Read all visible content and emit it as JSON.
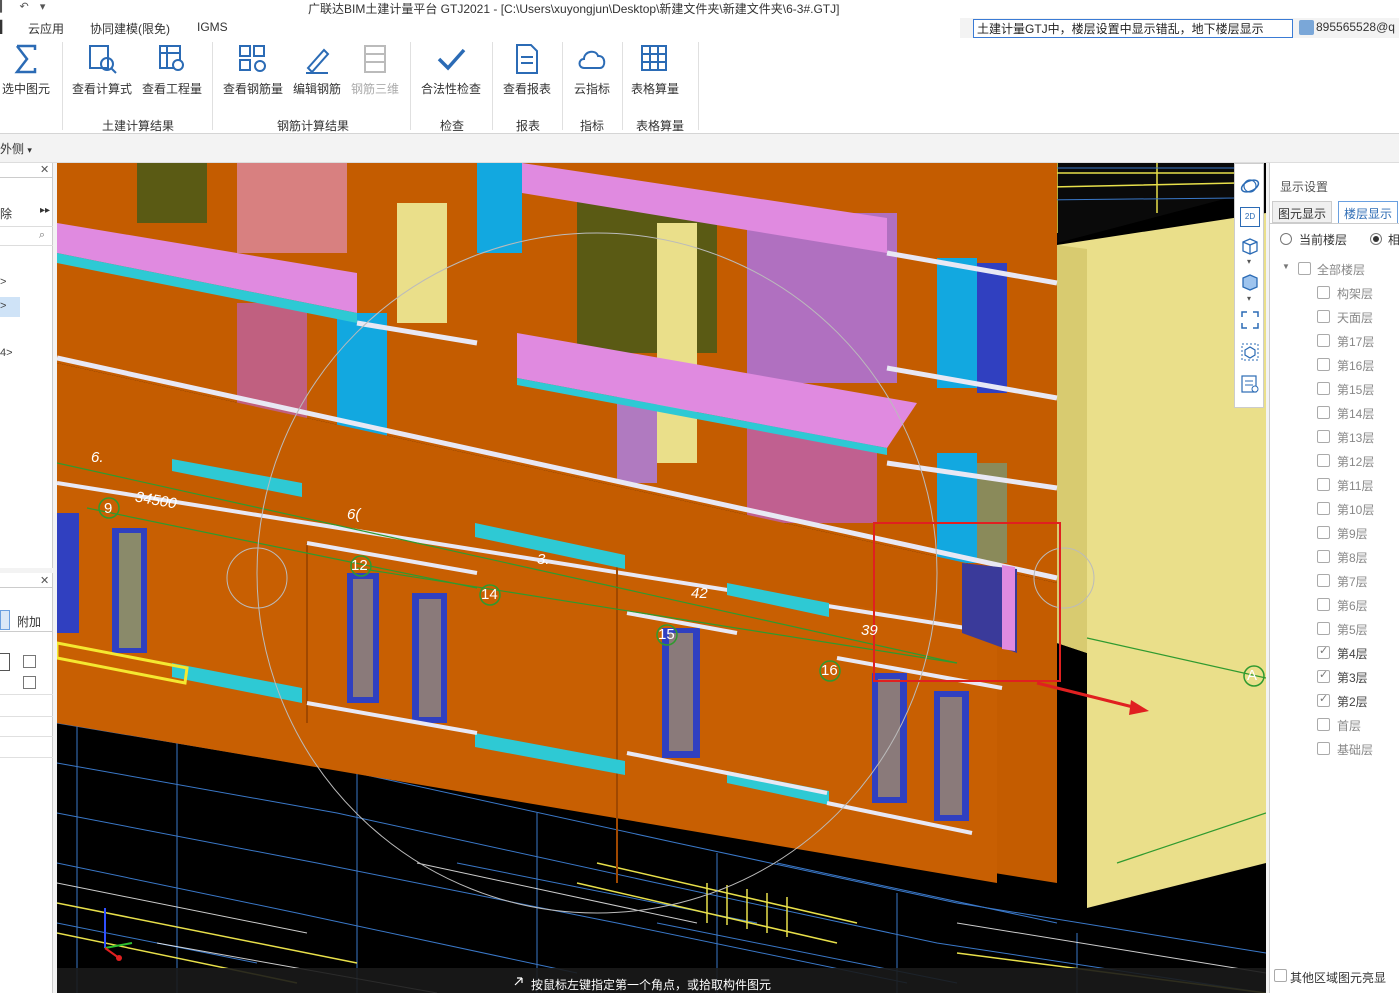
{
  "window": {
    "title": "广联达BIM土建计量平台 GTJ2021 - [C:\\Users\\xuyongjun\\Desktop\\新建文件夹\\新建文件夹\\6-3#.GTJ]"
  },
  "menubar": {
    "items": [
      "云应用",
      "协同建模(限免)",
      "IGMS"
    ]
  },
  "search": {
    "value": "土建计量GTJ中，楼层设置中显示错乱，地下楼层显示"
  },
  "user": {
    "name": "895565528@q"
  },
  "ribbon": {
    "buttons": [
      {
        "label": "选中图元"
      },
      {
        "label": "查看计算式"
      },
      {
        "label": "查看工程量"
      },
      {
        "label": "查看钢筋量"
      },
      {
        "label": "编辑钢筋"
      },
      {
        "label": "钢筋三维"
      },
      {
        "label": "合法性检查"
      },
      {
        "label": "查看报表"
      },
      {
        "label": "云指标"
      },
      {
        "label": "表格算量"
      }
    ],
    "groups": [
      "土建计算结果",
      "钢筋计算结果",
      "检查",
      "报表",
      "指标",
      "表格算量"
    ]
  },
  "toolbar": {
    "outer_dropdown": "外侧"
  },
  "left_panel": {
    "delete_label": "除",
    "tab_label": "附加",
    "tree_items": [
      ">",
      ">",
      "4>"
    ]
  },
  "viewport": {
    "status_hint": "按鼠标左键指定第一个角点，或拾取构件图元",
    "axis_labels": [
      "9",
      "12",
      "14",
      "15",
      "16",
      "A"
    ],
    "dimension_labels": [
      "6.",
      "34500",
      "6(",
      "3.",
      "42",
      "39"
    ],
    "view_buttons": [
      "2D"
    ],
    "colors": {
      "wall": "#c45c00",
      "yellow_wall": "#eadf8a",
      "cyan": "#2ec9d4",
      "pink": "#e08ae0",
      "blue_window": "#12a8e0",
      "highlight_box": "#e02020"
    }
  },
  "right_panel": {
    "title": "显示设置",
    "tabs": [
      "图元显示",
      "楼层显示"
    ],
    "radio": {
      "current": "当前楼层",
      "other": "相"
    },
    "all_floors": "全部楼层",
    "floors": [
      {
        "label": "构架层",
        "checked": false
      },
      {
        "label": "天面层",
        "checked": false
      },
      {
        "label": "第17层",
        "checked": false
      },
      {
        "label": "第16层",
        "checked": false
      },
      {
        "label": "第15层",
        "checked": false
      },
      {
        "label": "第14层",
        "checked": false
      },
      {
        "label": "第13层",
        "checked": false
      },
      {
        "label": "第12层",
        "checked": false
      },
      {
        "label": "第11层",
        "checked": false
      },
      {
        "label": "第10层",
        "checked": false
      },
      {
        "label": "第9层",
        "checked": false
      },
      {
        "label": "第8层",
        "checked": false
      },
      {
        "label": "第7层",
        "checked": false
      },
      {
        "label": "第6层",
        "checked": false
      },
      {
        "label": "第5层",
        "checked": false
      },
      {
        "label": "第4层",
        "checked": true
      },
      {
        "label": "第3层",
        "checked": true
      },
      {
        "label": "第2层",
        "checked": true
      },
      {
        "label": "首层",
        "checked": false
      },
      {
        "label": "基础层",
        "checked": false
      }
    ],
    "bottom_option": "其他区域图元亮显"
  }
}
